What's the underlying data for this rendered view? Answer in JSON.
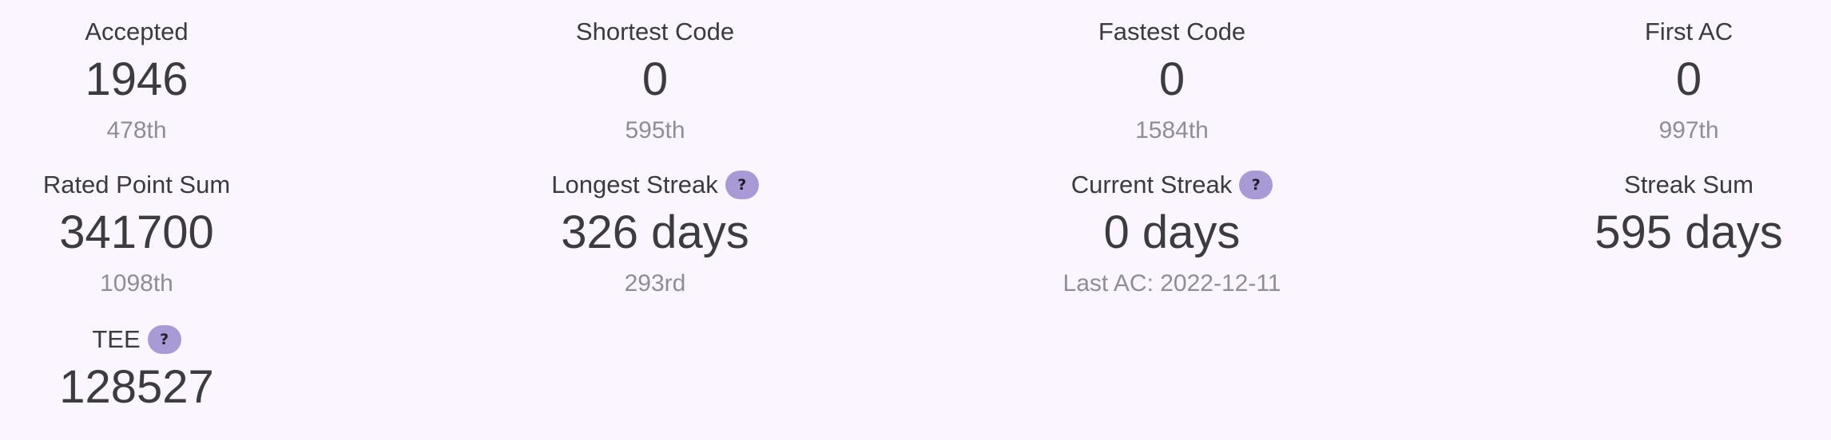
{
  "stats": {
    "accepted": {
      "label": "Accepted",
      "value": "1946",
      "rank": "478th"
    },
    "shortest_code": {
      "label": "Shortest Code",
      "value": "0",
      "rank": "595th"
    },
    "fastest_code": {
      "label": "Fastest Code",
      "value": "0",
      "rank": "1584th"
    },
    "first_ac": {
      "label": "First AC",
      "value": "0",
      "rank": "997th"
    },
    "rated_point_sum": {
      "label": "Rated Point Sum",
      "value": "341700",
      "rank": "1098th"
    },
    "longest_streak": {
      "label": "Longest Streak",
      "value": "326 days",
      "rank": "293rd",
      "help": "?"
    },
    "current_streak": {
      "label": "Current Streak",
      "value": "0 days",
      "sub": "Last AC: 2022-12-11",
      "help": "?"
    },
    "streak_sum": {
      "label": "Streak Sum",
      "value": "595 days"
    },
    "tee": {
      "label": "TEE",
      "value": "128527",
      "help": "?"
    }
  },
  "icons": {
    "help": "question-mark-icon"
  },
  "colors": {
    "background": "#faf5fe",
    "text": "#3b3b40",
    "muted": "#8e8e96",
    "help_badge": "#a99ad6"
  }
}
